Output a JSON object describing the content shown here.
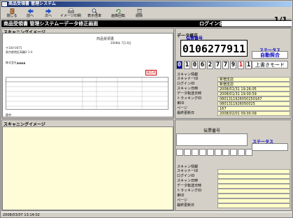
{
  "window": {
    "title": "商品受領書 管理システム"
  },
  "toolbar": {
    "items": [
      {
        "label": "閉じる",
        "icon": "door-icon"
      },
      {
        "label": "前へ",
        "icon": "arrow-left-icon"
      },
      {
        "label": "次へ",
        "icon": "arrow-right-icon"
      },
      {
        "label": "イメージ印刷",
        "icon": "printer-icon"
      },
      {
        "label": "表示倍率",
        "icon": "magnifier-icon"
      },
      {
        "label": "画像回転",
        "icon": "rotate-icon"
      },
      {
        "label": "削除",
        "icon": "delete-icon"
      }
    ],
    "page_indicator": "1/1"
  },
  "header": {
    "title": "商品受領書 管理システムーデータ修正画面",
    "login_label": "ログイン名:",
    "login_value": ""
  },
  "top": {
    "scan_label": "スキャニングイメージ",
    "data_fix_label": "データ修正",
    "denpyo_label": "伝票番号",
    "denpyo_number": "0106277911",
    "status_label": "ステータス",
    "status_value": "自動照合",
    "mode_value": "上書きモード",
    "digits": [
      "0",
      "1",
      "0",
      "6",
      "2",
      "7",
      "7",
      "9",
      "1",
      "1"
    ],
    "info_header": "スキャン情報",
    "info": [
      {
        "k": "スキャナーID",
        "v": "新宿支店"
      },
      {
        "k": "ログインID",
        "v": "新宿支店"
      },
      {
        "k": "スキャン日時",
        "v": "2008/01/31 19:26:05"
      },
      {
        "k": "データ転送日時",
        "v": "2008/01/31 19:00:59"
      },
      {
        "k": "トラッキングID",
        "v": "0801311926050250167"
      },
      {
        "k": "束ID",
        "v": "0801311926050025"
      },
      {
        "k": "ページ",
        "v": "167"
      },
      {
        "k": "最終更新日",
        "v": "2008/02/01 09:00:09"
      }
    ],
    "doc": {
      "heading": "商品受領書",
      "date": "2008年 7月 8日",
      "addr1": "〒100-0075",
      "addr2": "東京都港区高輪2-1-4",
      "company": "株式会社▲▲▲▲",
      "stamp": "検品済",
      "note_label": "備考:"
    }
  },
  "bottom": {
    "scan_label": "スキャニングイメージ",
    "denpyo_label": "伝票番号",
    "status_label": "ステータス",
    "info_header": "スキャン情報",
    "info": [
      {
        "k": "スキャナーID",
        "v": ""
      },
      {
        "k": "ログインID",
        "v": ""
      },
      {
        "k": "スキャン日時",
        "v": ""
      },
      {
        "k": "データ転送日時",
        "v": ""
      },
      {
        "k": "トラッキングID",
        "v": ""
      },
      {
        "k": "束ID",
        "v": ""
      },
      {
        "k": "ページ",
        "v": ""
      },
      {
        "k": "最終更新日",
        "v": ""
      }
    ]
  },
  "statusbar": {
    "text": "2008/03/07 13:14:02"
  }
}
